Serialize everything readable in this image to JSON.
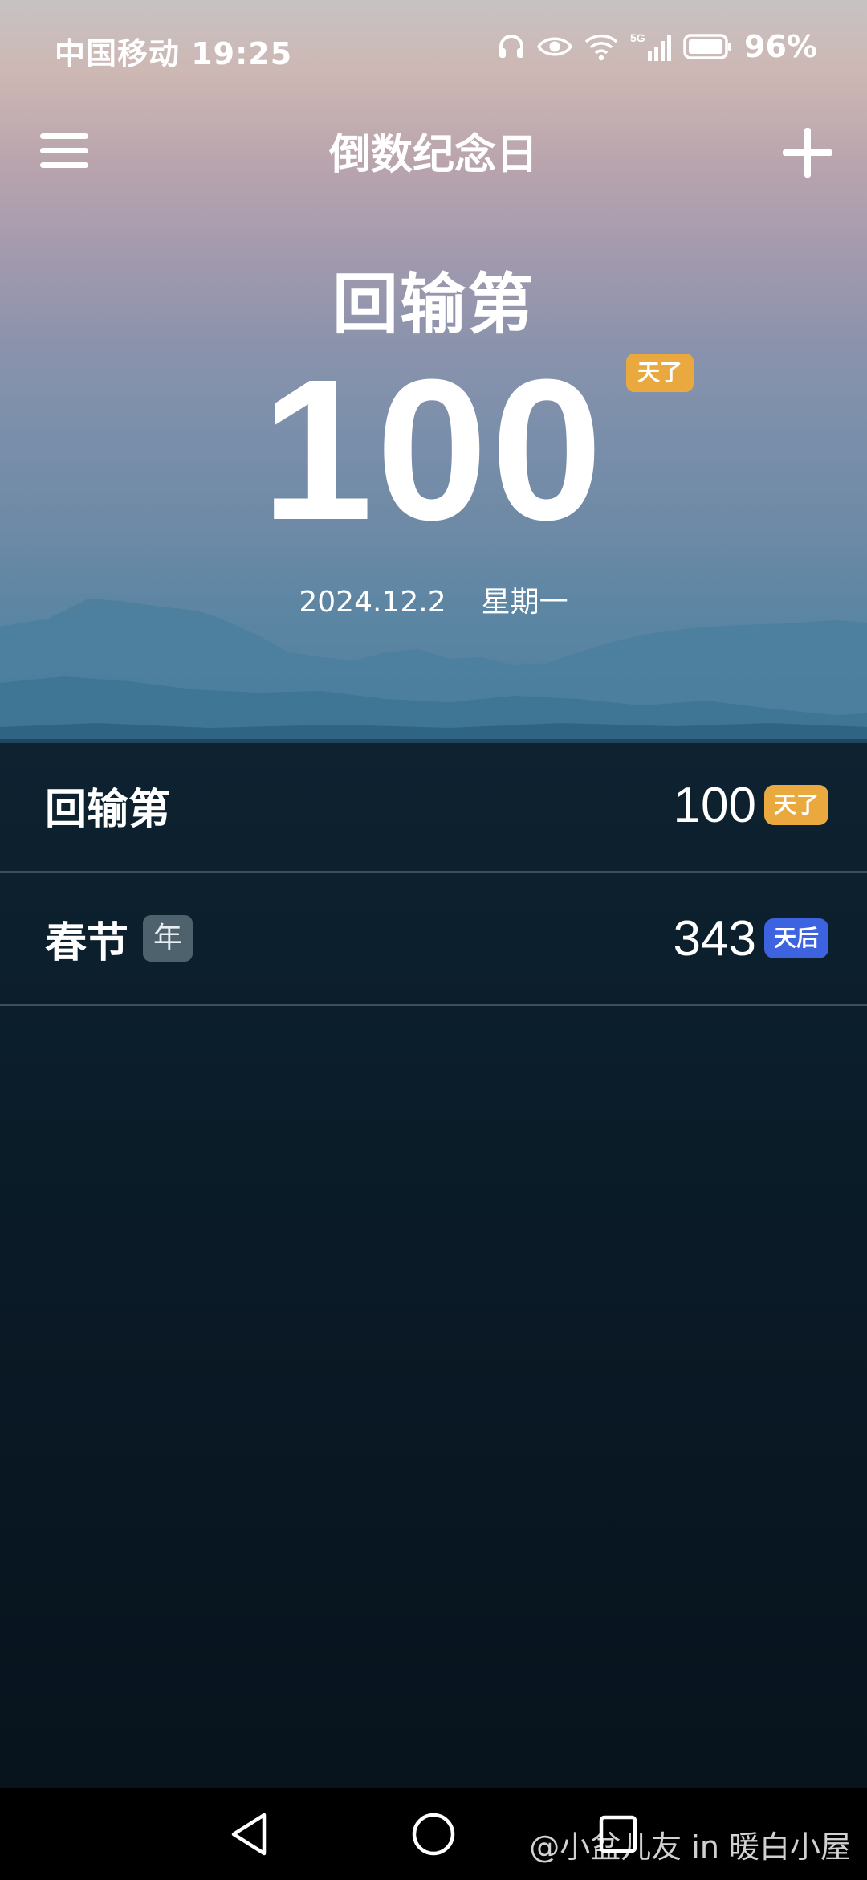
{
  "status_bar": {
    "carrier_time": "中国移动 19:25",
    "network": "5G",
    "battery": "96%",
    "icons": [
      "headphones-icon",
      "eye-icon",
      "wifi-icon",
      "signal-icon",
      "battery-icon"
    ]
  },
  "app_bar": {
    "title": "倒数纪念日",
    "menu_icon": "hamburger-menu-icon",
    "add_icon": "plus-icon"
  },
  "hero": {
    "name": "回输第",
    "count": "100",
    "unit": "天了",
    "date": "2024.12.2",
    "weekday": "星期一"
  },
  "events": [
    {
      "name": "回输第",
      "tag": "",
      "count": "100",
      "unit": "天了",
      "unit_color": "#e9a93f"
    },
    {
      "name": "春节",
      "tag": "年",
      "count": "343",
      "unit": "天后",
      "unit_color": "#3e63e0"
    }
  ],
  "nav_bar": {
    "back_icon": "back-triangle-icon",
    "home_icon": "home-circle-icon",
    "recents_icon": "recents-square-icon"
  },
  "watermark": "@小盆儿友 in 暖白小屋",
  "colors": {
    "since_badge": "#e9a93f",
    "until_badge": "#3e63e0"
  }
}
